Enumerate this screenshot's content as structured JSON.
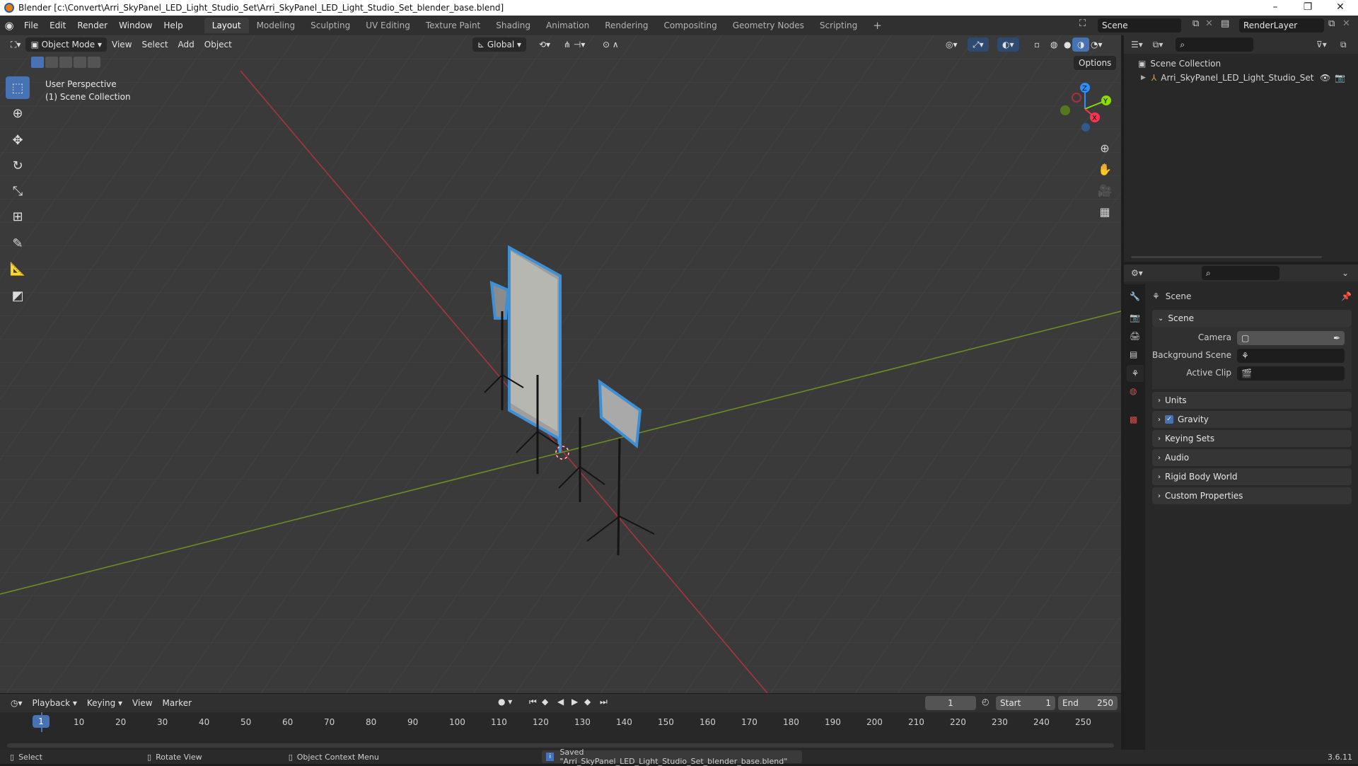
{
  "window": {
    "title": "Blender [c:\\Convert\\Arri_SkyPanel_LED_Light_Studio_Set\\Arri_SkyPanel_LED_Light_Studio_Set_blender_base.blend]",
    "min_glyph": "–",
    "max_glyph": "❐",
    "close_glyph": "✕"
  },
  "menubar": {
    "menus": [
      "File",
      "Edit",
      "Render",
      "Window",
      "Help"
    ],
    "workspaces": [
      "Layout",
      "Modeling",
      "Sculpting",
      "UV Editing",
      "Texture Paint",
      "Shading",
      "Animation",
      "Rendering",
      "Compositing",
      "Geometry Nodes",
      "Scripting"
    ],
    "add_glyph": "+",
    "scene_name": "Scene",
    "view_layer": "RenderLayer"
  },
  "viewport_header": {
    "mode": "Object Mode",
    "menus": [
      "View",
      "Select",
      "Add",
      "Object"
    ],
    "transform_orientation": "Global",
    "options": "Options"
  },
  "viewport": {
    "perspective": "User Perspective",
    "collection": "(1) Scene Collection",
    "gizmo_axes": [
      "Z",
      "Y",
      "X"
    ]
  },
  "outliner": {
    "root": "Scene Collection",
    "items": [
      "Arri_SkyPanel_LED_Light_Studio_Set"
    ]
  },
  "properties": {
    "context": "Scene",
    "section": "Scene",
    "fields": [
      {
        "label": "Camera",
        "value": ""
      },
      {
        "label": "Background Scene",
        "value": ""
      },
      {
        "label": "Active Clip",
        "value": ""
      }
    ],
    "panels": [
      "Units",
      "Gravity",
      "Keying Sets",
      "Audio",
      "Rigid Body World",
      "Custom Properties"
    ],
    "gravity_checked": true
  },
  "timeline": {
    "menus": [
      "Playback",
      "Keying",
      "View",
      "Marker"
    ],
    "current_frame": "1",
    "start_label": "Start",
    "start": "1",
    "end_label": "End",
    "end": "250",
    "ticks": [
      "10",
      "20",
      "30",
      "40",
      "50",
      "60",
      "70",
      "80",
      "90",
      "100",
      "110",
      "120",
      "130",
      "140",
      "150",
      "160",
      "170",
      "180",
      "190",
      "200",
      "210",
      "220",
      "230",
      "240",
      "250"
    ]
  },
  "statusbar": {
    "select": "Select",
    "rotate": "Rotate View",
    "context_menu": "Object Context Menu",
    "message": "Saved \"Arri_SkyPanel_LED_Light_Studio_Set_blender_base.blend\"",
    "version": "3.6.11"
  },
  "colors": {
    "accent": "#4772b3",
    "x_axis": "#ff3352",
    "y_axis": "#8bdc00",
    "z_axis": "#2890ff"
  }
}
